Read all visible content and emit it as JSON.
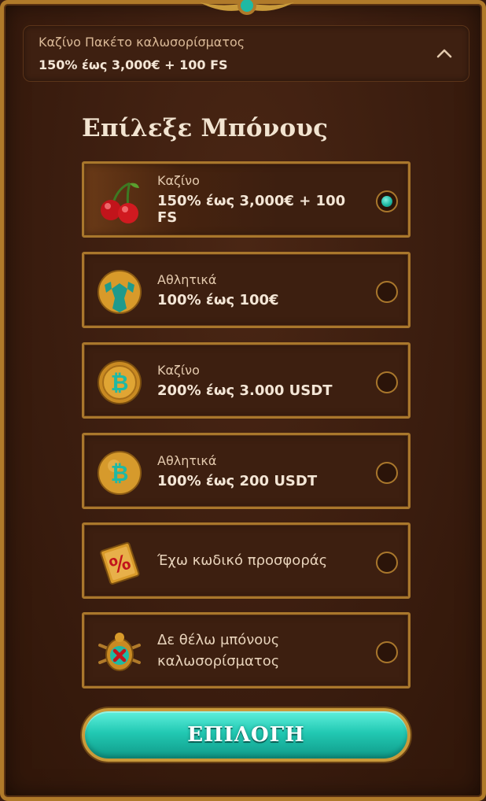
{
  "header": {
    "subtitle": "Καζίνο Πακέτο καλωσορίσματος",
    "offer": "150% έως 3,000€ + 100 FS"
  },
  "title": "Επίλεξε Μπόνους",
  "options": [
    {
      "category": "Καζίνο",
      "value": "150% έως 3,000€ + 100 FS",
      "icon": "cherries-icon",
      "selected": true
    },
    {
      "category": "Αθλητικά",
      "value": "100% έως 100€",
      "icon": "soccer-ball-icon",
      "selected": false
    },
    {
      "category": "Καζίνο",
      "value": "200% έως 3.000 USDT",
      "icon": "bitcoin-coin-icon",
      "selected": false
    },
    {
      "category": "Αθλητικά",
      "value": "100% έως 200 USDT",
      "icon": "bitcoin-ball-icon",
      "selected": false
    },
    {
      "label": "Έχω κωδικό προσφοράς",
      "icon": "percent-tablet-icon",
      "selected": false
    },
    {
      "label_line1": "Δε θέλω μπόνους",
      "label_line2": "καλωσορίσματος",
      "icon": "scarab-cross-icon",
      "selected": false
    }
  ],
  "cta_label": "ΕΠΙΛΟΓΗ",
  "colors": {
    "accent": "#22c9b3",
    "frame_gold": "#a9772c",
    "background": "#3b1d0f"
  }
}
